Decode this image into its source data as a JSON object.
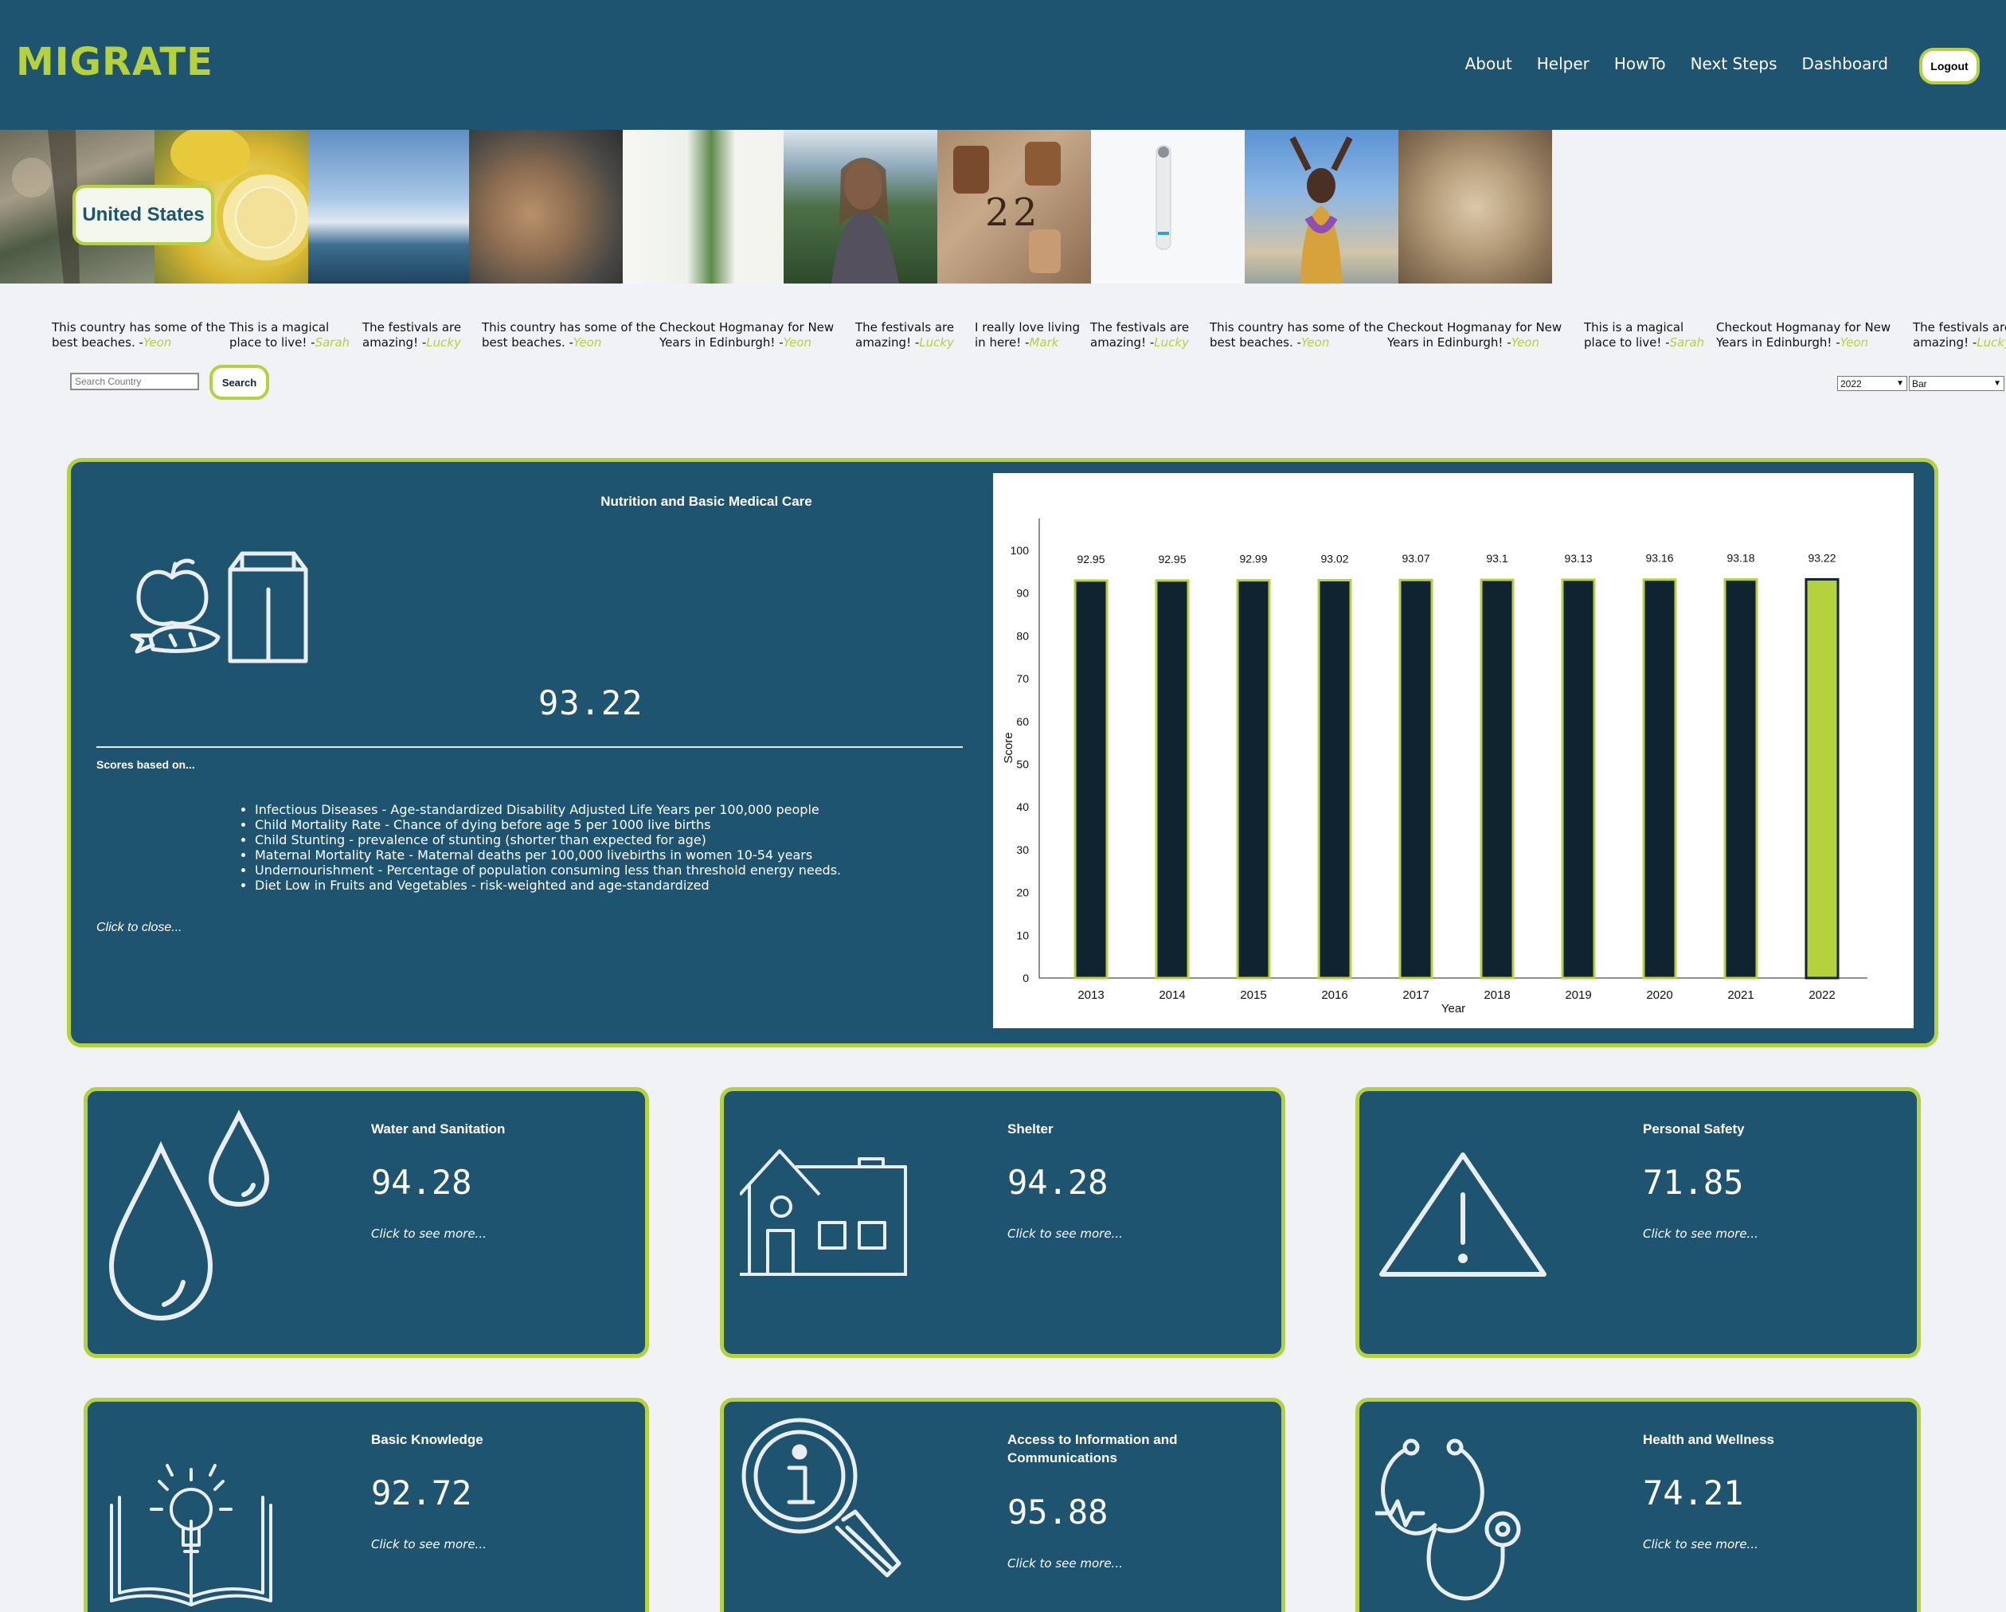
{
  "app": {
    "logo": "MIGRATE"
  },
  "nav": {
    "items": [
      "About",
      "Helper",
      "HowTo",
      "Next Steps",
      "Dashboard"
    ],
    "logout_label": "Logout"
  },
  "hero": {
    "country": "United States"
  },
  "testimonials": [
    {
      "text": "This country has some of the best beaches. -",
      "author": "Yeon"
    },
    {
      "text": "This is a magical place to live! -",
      "author": "Sarah"
    },
    {
      "text": "The festivals are amazing! -",
      "author": "Lucky"
    },
    {
      "text": "This country has some of the best beaches. -",
      "author": "Yeon"
    },
    {
      "text": "Checkout Hogmanay for New Years in Edinburgh! -",
      "author": "Yeon"
    },
    {
      "text": "The festivals are amazing! -",
      "author": "Lucky"
    },
    {
      "text": "I really love living in here! -",
      "author": "Mark"
    },
    {
      "text": "The festivals are amazing! -",
      "author": "Lucky"
    },
    {
      "text": "This country has some of the best beaches. -",
      "author": "Yeon"
    },
    {
      "text": "Checkout Hogmanay for New Years in Edinburgh! -",
      "author": "Yeon"
    },
    {
      "text": "This is a magical place to live! -",
      "author": "Sarah"
    },
    {
      "text": "Checkout Hogmanay for New Years in Edinburgh! -",
      "author": "Yeon"
    },
    {
      "text": "The festivals are amazing! -",
      "author": "Lucky"
    }
  ],
  "search": {
    "placeholder": "Search Country",
    "button_label": "Search",
    "year_select": "2022",
    "chart_type_select": "Bar"
  },
  "main_panel": {
    "title": "Nutrition and Basic Medical Care",
    "score": "93.22",
    "based_on_label": "Scores based on...",
    "indicators": [
      "Infectious Diseases - Age-standardized Disability Adjusted Life Years per 100,000 people",
      "Child Mortality Rate - Chance of dying before age 5 per 1000 live births",
      "Child Stunting - prevalence of stunting (shorter than expected for age)",
      "Maternal Mortality Rate - Maternal deaths per 100,000 livebirths in women 10-54 years",
      "Undernourishment - Percentage of population consuming less than threshold energy needs.",
      "Diet Low in Fruits and Vegetables - risk-weighted and age-standardized"
    ],
    "close_label": "Click to close..."
  },
  "chart_data": {
    "type": "bar",
    "categories": [
      "2013",
      "2014",
      "2015",
      "2016",
      "2017",
      "2018",
      "2019",
      "2020",
      "2021",
      "2022"
    ],
    "values": [
      92.95,
      92.95,
      92.99,
      93.02,
      93.07,
      93.1,
      93.13,
      93.16,
      93.18,
      93.22
    ],
    "value_labels": [
      "92.95",
      "92.95",
      "92.99",
      "93.02",
      "93.07",
      "93.1",
      "93.13",
      "93.16",
      "93.18",
      "93.22"
    ],
    "highlight_category": "2022",
    "xlabel": "Year",
    "ylabel": "Score",
    "ylim": [
      0,
      100
    ],
    "yticks": [
      0,
      10,
      20,
      30,
      40,
      50,
      60,
      70,
      80,
      90,
      100
    ],
    "grid": false,
    "colors": {
      "bar": "#0f2430",
      "bar_border": "#b6d13e",
      "highlight": "#b6d13e",
      "highlight_border": "#0f2430"
    }
  },
  "cards": [
    {
      "title": "Water and Sanitation",
      "score": "94.28",
      "more": "Click to see more...",
      "icon": "water-drops-icon"
    },
    {
      "title": "Shelter",
      "score": "94.28",
      "more": "Click to see more...",
      "icon": "house-icon"
    },
    {
      "title": "Personal Safety",
      "score": "71.85",
      "more": "Click to see more...",
      "icon": "warning-icon"
    },
    {
      "title": "Basic Knowledge",
      "score": "92.72",
      "more": "Click to see more...",
      "icon": "book-lightbulb-icon"
    },
    {
      "title": "Access to Information and Communications",
      "score": "95.88",
      "more": "Click to see more...",
      "icon": "info-magnifier-icon"
    },
    {
      "title": "Health and Wellness",
      "score": "74.21",
      "more": "Click to see more...",
      "icon": "stethoscope-icon"
    }
  ],
  "theme": {
    "primary": "#1e5470",
    "accent": "#b6d13e",
    "background": "#f0f2f5",
    "dark": "#0f2430"
  }
}
